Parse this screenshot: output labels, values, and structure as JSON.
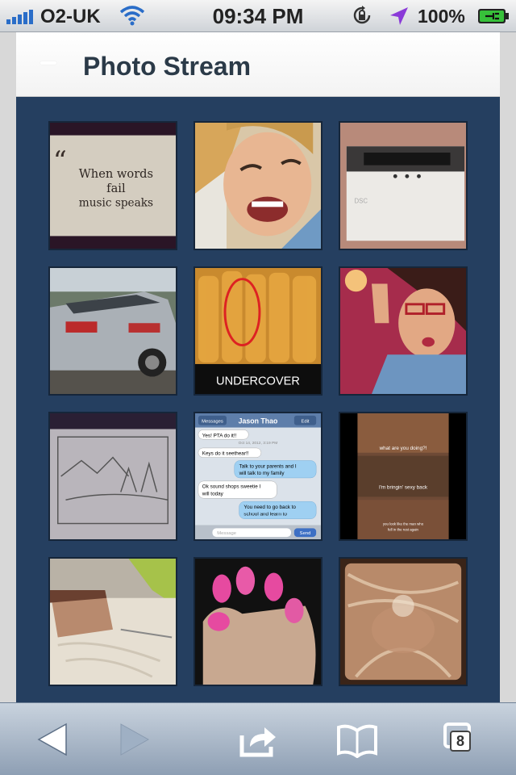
{
  "status": {
    "carrier": "O2-UK",
    "time": "09:34 PM",
    "battery": "100%",
    "icons": [
      "signal-bars-icon",
      "wifi-icon",
      "rotation-lock-icon",
      "location-arrow-icon",
      "battery-charging-icon"
    ]
  },
  "header": {
    "title": "Photo Stream"
  },
  "photos": [
    {
      "name": "quote-photo",
      "quote_line1": "When words",
      "quote_line2": "fail",
      "quote_line3": "music speaks"
    },
    {
      "name": "selfie-wink-photo"
    },
    {
      "name": "dsc-box-photo",
      "label": "DSC"
    },
    {
      "name": "car-photo"
    },
    {
      "name": "soda-bottles-photo",
      "caption": "UNDERCOVER"
    },
    {
      "name": "glasses-selfie-photo"
    },
    {
      "name": "sketch-photo"
    },
    {
      "name": "messages-screenshot-photo",
      "back": "Messages",
      "contact": "Jason Thao",
      "edit": "Edit",
      "date": "Oct 14, 2012, 3:19 PM",
      "bubbles": [
        "Yes! PTA do it!!",
        "Keys do it seethear!!",
        "Talk to your parents and I",
        "will talk to my family",
        "Ok sound shops sweetie I",
        "will today",
        "You need to go back to",
        "school and learn to"
      ],
      "placeholder": "Message",
      "send": "Send"
    },
    {
      "name": "tv-meme-photo",
      "line1": "what are you doing?!",
      "line2": "I'm bringin' sexy back",
      "line3": "you look like the man who",
      "line4": "fell in the rest again"
    },
    {
      "name": "tiramisu-photo"
    },
    {
      "name": "pink-nails-photo"
    },
    {
      "name": "hair-closeup-photo"
    }
  ],
  "toolbar": {
    "tab_count": "8",
    "buttons": [
      "back-icon",
      "forward-icon",
      "share-icon",
      "bookmarks-icon",
      "tabs-icon"
    ]
  },
  "colors": {
    "stream_bg": "#253f60",
    "title": "#2b3a48",
    "accent": "#2a6dc8"
  }
}
